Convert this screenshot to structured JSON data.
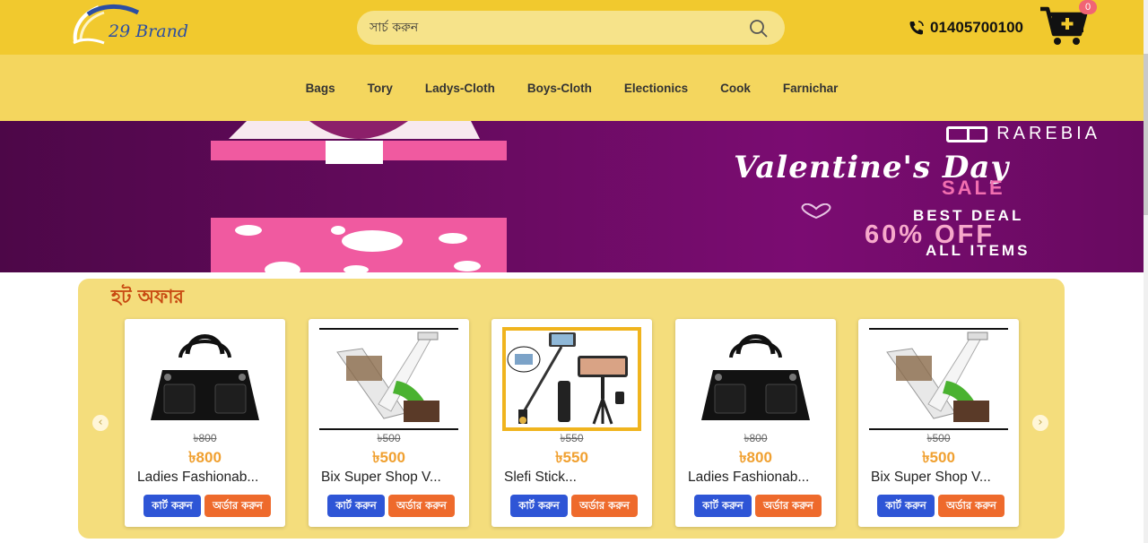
{
  "header": {
    "logo_text": "29 Brand",
    "search_placeholder": "সার্চ করুন",
    "phone": "01405700100",
    "cart_count": "0"
  },
  "nav": {
    "categories": [
      "Bags",
      "Tory",
      "Ladys-Cloth",
      "Boys-Cloth",
      "Electionics",
      "Cook",
      "Farnichar"
    ]
  },
  "banner": {
    "brand": "RAREBIA",
    "title": "Valentine's Day",
    "sale": "SALE",
    "best_deal": "BEST DEAL",
    "discount": "60% OFF",
    "all_items": "ALL ITEMS"
  },
  "hot_offer": {
    "title": "হট অফার",
    "products": [
      {
        "name": "Ladies Fashionab...",
        "old_price": "৳800",
        "price": "৳800",
        "cart_label": "কার্ট করুন",
        "order_label": "অর্ডার করুন",
        "image": "handbag"
      },
      {
        "name": "Bix Super Shop V...",
        "old_price": "৳500",
        "price": "৳500",
        "cart_label": "কার্ট করুন",
        "order_label": "অর্ডার করুন",
        "image": "slicer"
      },
      {
        "name": "Slefi Stick...",
        "old_price": "৳550",
        "price": "৳550",
        "cart_label": "কার্ট করুন",
        "order_label": "অর্ডার করুন",
        "image": "selfie-stick"
      },
      {
        "name": "Ladies Fashionab...",
        "old_price": "৳800",
        "price": "৳800",
        "cart_label": "কার্ট করুন",
        "order_label": "অর্ডার করুন",
        "image": "handbag"
      },
      {
        "name": "Bix Super Shop V...",
        "old_price": "৳500",
        "price": "৳500",
        "cart_label": "কার্ট করুন",
        "order_label": "অর্ডার করুন",
        "image": "slicer"
      }
    ]
  },
  "colors": {
    "header_bg": "#f1c92e",
    "nav_bg": "#f4d65e",
    "hot_bg": "#f4dd7c",
    "price": "#f0a030",
    "cart_button": "#2e55d6",
    "order_button": "#ee6a2c"
  }
}
